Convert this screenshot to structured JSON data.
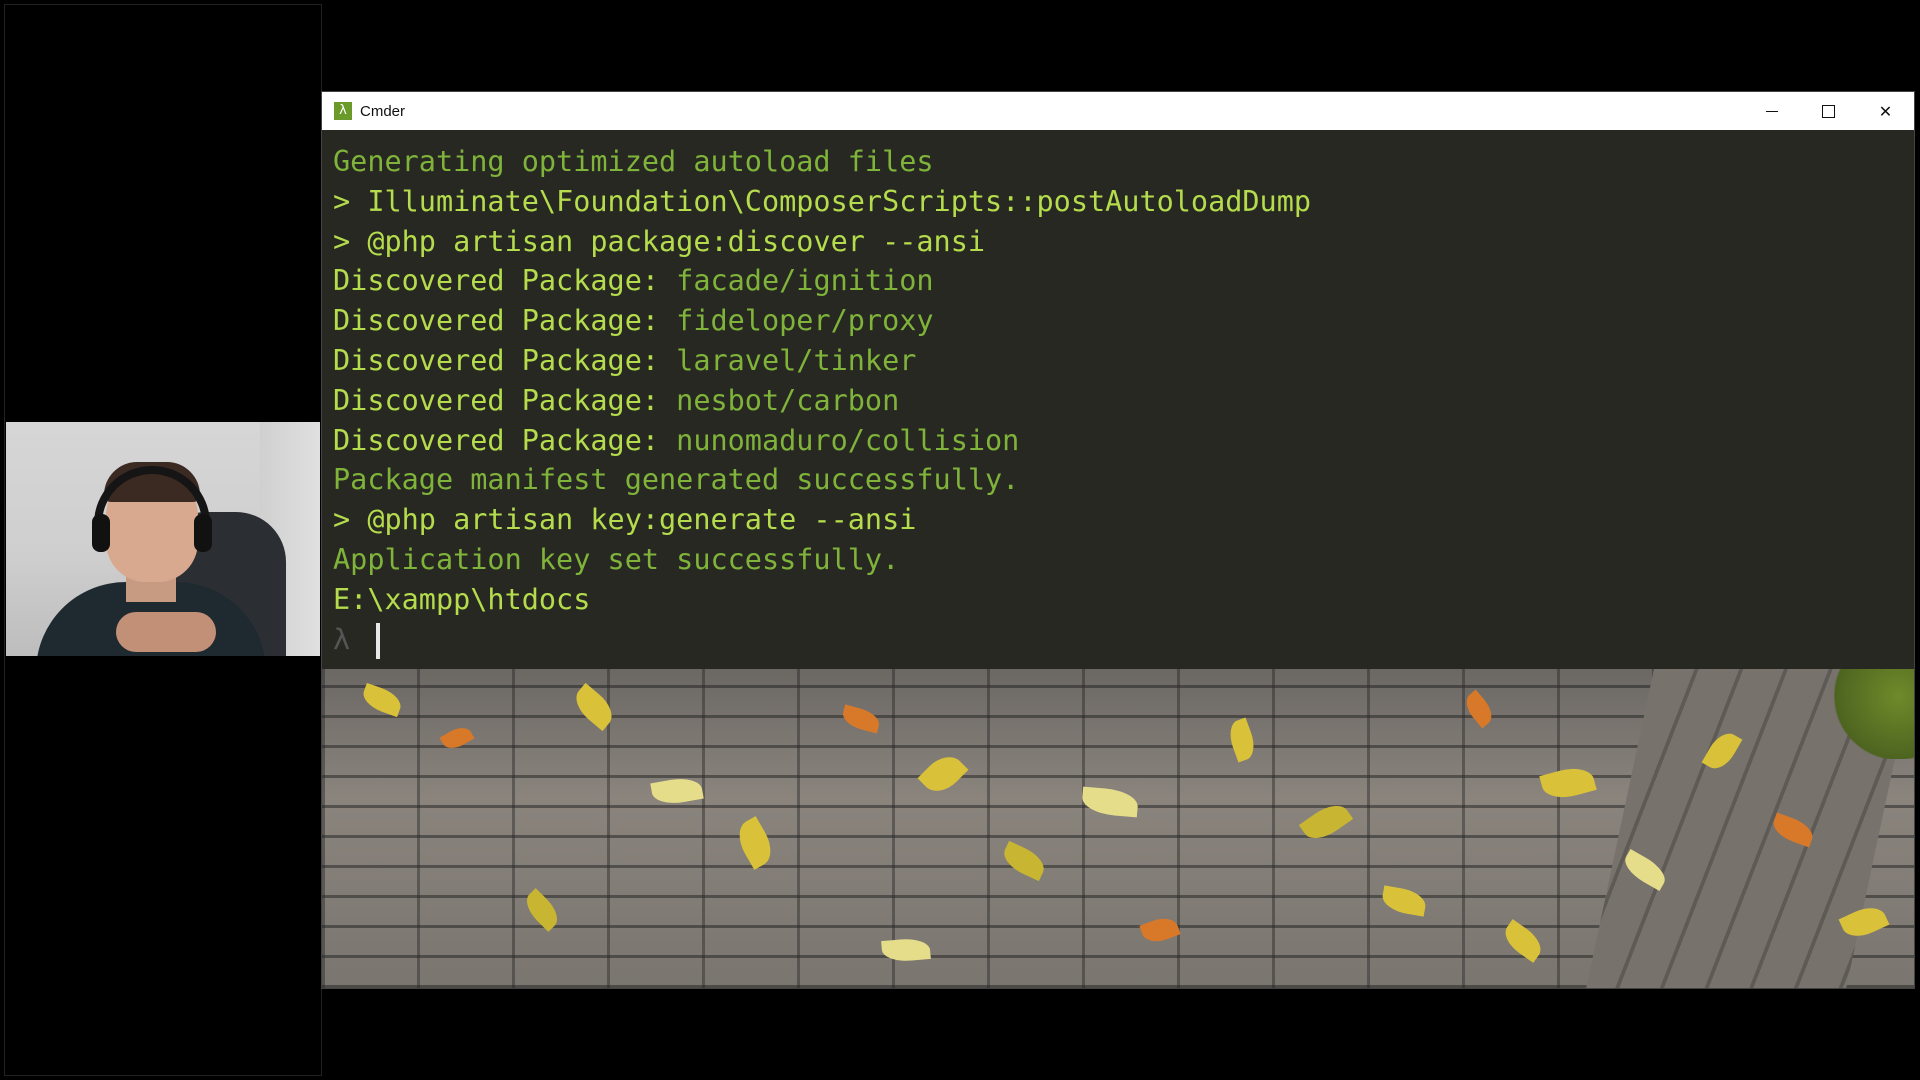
{
  "window": {
    "title": "Cmder",
    "icon": "lambda-icon",
    "controls": [
      "minimize-icon",
      "maximize-icon",
      "close-icon"
    ],
    "close_glyph": "✕"
  },
  "terminal": {
    "lines": [
      {
        "text": "Generating optimized autoload files",
        "color": "#7fb33a"
      },
      {
        "text": "> Illuminate\\Foundation\\ComposerScripts::postAutoloadDump",
        "color": "#b4dc4c"
      },
      {
        "text": "> @php artisan package:discover --ansi",
        "color": "#b4dc4c"
      },
      {
        "label": "Discovered Package: ",
        "value": "facade/ignition"
      },
      {
        "label": "Discovered Package: ",
        "value": "fideloper/proxy"
      },
      {
        "label": "Discovered Package: ",
        "value": "laravel/tinker"
      },
      {
        "label": "Discovered Package: ",
        "value": "nesbot/carbon"
      },
      {
        "label": "Discovered Package: ",
        "value": "nunomaduro/collision"
      },
      {
        "text": "Package manifest generated successfully.",
        "color": "#7fb33a"
      },
      {
        "text": "> @php artisan key:generate --ansi",
        "color": "#b4dc4c"
      },
      {
        "text": "Application key set successfully.",
        "color": "#7fb33a"
      },
      {
        "text": "E:\\xampp\\htdocs",
        "color": "#b4dc4c"
      }
    ],
    "prompt_symbol": "λ"
  },
  "colors": {
    "terminal_bg": "#272822",
    "output_green": "#7fb33a",
    "command_green": "#b4dc4c"
  }
}
